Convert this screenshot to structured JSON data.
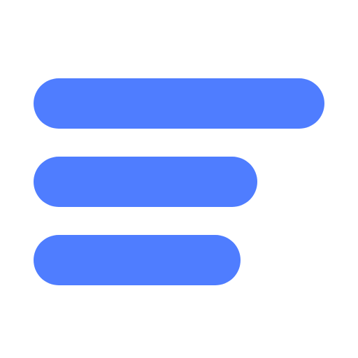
{
  "icon": {
    "name": "menu-lines-icon",
    "color": "#4F7DFF",
    "background": "#FFFFFF",
    "bar_count": 3
  }
}
